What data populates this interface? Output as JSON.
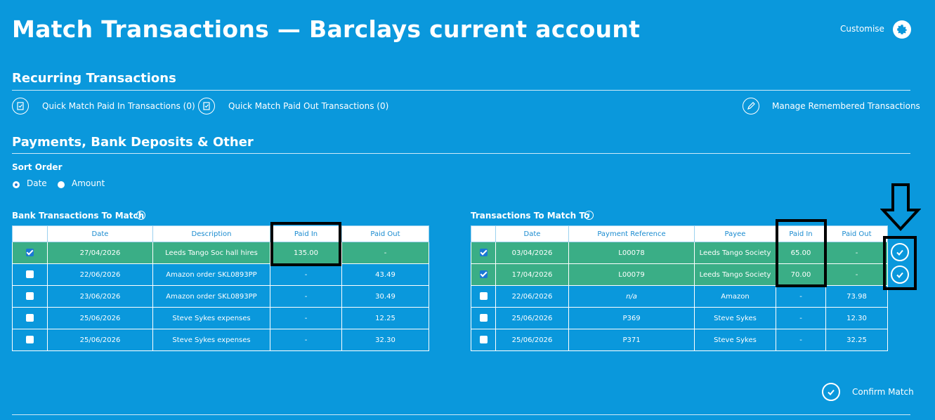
{
  "header": {
    "title": "Match Transactions — Barclays current account",
    "customise_label": "Customise"
  },
  "recurring": {
    "title": "Recurring Transactions",
    "quick_paid_in": "Quick Match Paid In Transactions (0)",
    "quick_paid_out": "Quick Match Paid Out Transactions (0)",
    "manage_remembered": "Manage Remembered Transactions"
  },
  "payments": {
    "title": "Payments, Bank Deposits & Other",
    "sort_order_label": "Sort Order",
    "sort_options": [
      "Date",
      "Amount"
    ],
    "selected_sort": "Date"
  },
  "bank_table": {
    "title": "Bank Transactions To Match",
    "columns": [
      "Date",
      "Description",
      "Paid In",
      "Paid Out"
    ],
    "rows": [
      {
        "checked": true,
        "date": "27/04/2026",
        "description": "Leeds Tango Soc hall hires",
        "paid_in": "135.00",
        "paid_out": "-"
      },
      {
        "checked": false,
        "date": "22/06/2026",
        "description": "Amazon order SKL0893PP",
        "paid_in": "-",
        "paid_out": "43.49"
      },
      {
        "checked": false,
        "date": "23/06/2026",
        "description": "Amazon order SKL0893PP",
        "paid_in": "-",
        "paid_out": "30.49"
      },
      {
        "checked": false,
        "date": "25/06/2026",
        "description": "Steve Sykes expenses",
        "paid_in": "-",
        "paid_out": "12.25"
      },
      {
        "checked": false,
        "date": "25/06/2026",
        "description": "Steve Sykes expenses",
        "paid_in": "-",
        "paid_out": "32.30"
      }
    ]
  },
  "match_table": {
    "title": "Transactions To Match To",
    "columns": [
      "Date",
      "Payment Reference",
      "Payee",
      "Paid In",
      "Paid Out"
    ],
    "rows": [
      {
        "checked": true,
        "date": "03/04/2026",
        "reference": "L00078",
        "payee": "Leeds Tango Society",
        "paid_in": "65.00",
        "paid_out": "-"
      },
      {
        "checked": true,
        "date": "17/04/2026",
        "reference": "L00079",
        "payee": "Leeds Tango Society",
        "paid_in": "70.00",
        "paid_out": "-"
      },
      {
        "checked": false,
        "date": "22/06/2026",
        "reference": "n/a",
        "payee": "Amazon",
        "paid_in": "-",
        "paid_out": "73.98"
      },
      {
        "checked": false,
        "date": "25/06/2026",
        "reference": "P369",
        "payee": "Steve Sykes",
        "paid_in": "-",
        "paid_out": "12.30"
      },
      {
        "checked": false,
        "date": "25/06/2026",
        "reference": "P371",
        "payee": "Steve Sykes",
        "paid_in": "-",
        "paid_out": "32.25"
      }
    ]
  },
  "confirm_label": "Confirm Match",
  "colors": {
    "background": "#0a98dc",
    "matched_row": "#3aae86",
    "header_text": "#1a8bd0"
  }
}
